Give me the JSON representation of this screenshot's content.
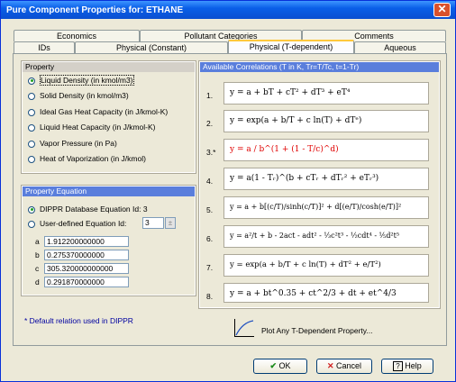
{
  "window": {
    "title": "Pure Component Properties for: ETHANE",
    "close": "✕"
  },
  "tabs_back": [
    "Economics",
    "Pollutant Categories",
    "Comments"
  ],
  "tabs_front": [
    "IDs",
    "Physical (Constant)",
    "Physical (T-dependent)",
    "Aqueous"
  ],
  "property": {
    "header": "Property",
    "items": [
      "Liquid Density (in kmol/m3)",
      "Solid Density (in kmol/m3)",
      "Ideal Gas Heat Capacity (in J/kmol-K)",
      "Liquid Heat Capacity (in J/kmol-K)",
      "Vapor Pressure (in Pa)",
      "Heat of Vaporization (in J/kmol)"
    ]
  },
  "equation": {
    "header": "Property Equation",
    "dippr": "DIPPR Database Equation Id: 3",
    "user": "User-defined Equation Id:",
    "user_id": "3",
    "labels": [
      "a",
      "b",
      "c",
      "d"
    ],
    "values": [
      "1.912200000000",
      "0.275370000000",
      "305.320000000000",
      "0.291870000000"
    ]
  },
  "footnote": "* Default relation used in DIPPR",
  "corr": {
    "header": "Available Correlations (T in K, Tr=T/Tc, t=1-Tr)",
    "nums": [
      "1.",
      "2.",
      "3.*",
      "4.",
      "5.",
      "6.",
      "7.",
      "8."
    ],
    "eqs": [
      "y = a + bT + cT² + dT³ + eT⁴",
      "y = exp(a + b/T + c ln(T) + dTᵉ)",
      "y = a / b^(1 + (1 - T/c)^d)",
      "y = a(1 - Tᵣ)^(b + cTᵣ + dTᵣ² + eTᵣ³)",
      "y = a + b[(c/T)/sinh(c/T)]² + d[(e/T)/cosh(e/T)]²",
      "y = a²/t + b - 2act - adt² - ⅓c²t³ - ½cdt⁴ - ⅕d²t⁵",
      "y = exp(a + b/T + c ln(T) + dT² + e/T²)",
      "y = a + bt^0.35 + ct^2/3 + dt + et^4/3"
    ]
  },
  "plot": "Plot Any T-Dependent Property...",
  "buttons": {
    "ok": "OK",
    "cancel": "Cancel",
    "help": "Help"
  }
}
